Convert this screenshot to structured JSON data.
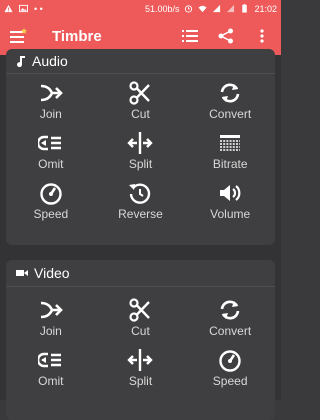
{
  "status_bar": {
    "speed": "51.00b/s",
    "time": "21:02"
  },
  "app_bar": {
    "title": "Timbre"
  },
  "audio_section": {
    "title": "Audio",
    "tools": [
      {
        "label": "Join",
        "icon": "join-icon"
      },
      {
        "label": "Cut",
        "icon": "scissors-icon"
      },
      {
        "label": "Convert",
        "icon": "convert-icon"
      },
      {
        "label": "Omit",
        "icon": "omit-icon"
      },
      {
        "label": "Split",
        "icon": "split-icon"
      },
      {
        "label": "Bitrate",
        "icon": "bitrate-icon"
      },
      {
        "label": "Speed",
        "icon": "speed-icon"
      },
      {
        "label": "Reverse",
        "icon": "reverse-icon"
      },
      {
        "label": "Volume",
        "icon": "volume-icon"
      }
    ]
  },
  "video_section": {
    "title": "Video",
    "tools": [
      {
        "label": "Join",
        "icon": "join-icon"
      },
      {
        "label": "Cut",
        "icon": "scissors-icon"
      },
      {
        "label": "Convert",
        "icon": "convert-icon"
      },
      {
        "label": "Omit",
        "icon": "omit-icon"
      },
      {
        "label": "Split",
        "icon": "split-icon"
      },
      {
        "label": "Speed",
        "icon": "speed-icon"
      }
    ]
  },
  "colors": {
    "accent": "#ee5a5a",
    "background": "#333335",
    "card": "#3f3f41"
  }
}
